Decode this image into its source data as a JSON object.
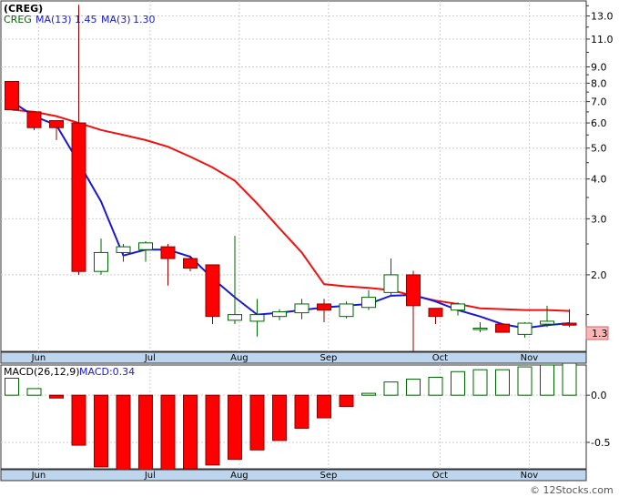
{
  "header": {
    "symbol": "(CREG)",
    "ticker": "CREG",
    "ma13_label": "MA(13)",
    "ma13_value": "1.45",
    "ma3_label": "MA(3)",
    "ma3_value": "1.30"
  },
  "macd_header": {
    "label": "MACD(26,12,9)",
    "value_label": "MACD:0.34"
  },
  "watermark": "© 12Stocks.com",
  "last_price_tag": "1.3",
  "colors": {
    "up_fill": "#ffffff",
    "up_stroke": "#006400",
    "down_fill": "#ff0000",
    "down_stroke": "#8b0000",
    "ma13": "#ee1111",
    "ma3": "#1a1acc",
    "macd_up": "#ffffff",
    "macd_up_stroke": "#006400",
    "macd_down": "#ff0000",
    "grid": "#cccccc",
    "axis_bar": "#bdd6ee",
    "price_tag_bg": "#f8b8b8"
  },
  "chart_data": [
    {
      "type": "candlestick",
      "title": "(CREG)",
      "y_scale": "log",
      "ylim": [
        1.15,
        14.5
      ],
      "y_ticks": [
        13.0,
        11.0,
        9.0,
        8.0,
        7.0,
        6.0,
        5.0,
        4.0,
        3.0,
        2.0
      ],
      "y_tick_labels": [
        "13.0",
        "11.0",
        "9.0",
        "8.0",
        "7.0",
        "6.0",
        "5.0",
        "4.0",
        "3.0",
        "2.0"
      ],
      "x_tick_labels": [
        "Jun",
        "Jul",
        "Aug",
        "Sep",
        "Oct",
        "Nov"
      ],
      "x_tick_positions": [
        1.2,
        6.2,
        10.2,
        14.2,
        19.2,
        23.2
      ],
      "grid": true,
      "candles": [
        {
          "o": 8.1,
          "h": 8.1,
          "l": 6.6,
          "c": 6.6
        },
        {
          "o": 6.5,
          "h": 6.5,
          "l": 5.7,
          "c": 5.8
        },
        {
          "o": 6.1,
          "h": 6.1,
          "l": 5.3,
          "c": 5.8
        },
        {
          "o": 6.0,
          "h": 14.1,
          "l": 2.0,
          "c": 2.05
        },
        {
          "o": 2.05,
          "h": 2.6,
          "l": 2.0,
          "c": 2.35
        },
        {
          "o": 2.35,
          "h": 2.5,
          "l": 2.2,
          "c": 2.45
        },
        {
          "o": 2.4,
          "h": 2.55,
          "l": 2.2,
          "c": 2.52
        },
        {
          "o": 2.45,
          "h": 2.5,
          "l": 1.85,
          "c": 2.25
        },
        {
          "o": 2.25,
          "h": 2.3,
          "l": 2.05,
          "c": 2.1
        },
        {
          "o": 2.15,
          "h": 2.15,
          "l": 1.4,
          "c": 1.48
        },
        {
          "o": 1.44,
          "h": 2.65,
          "l": 1.4,
          "c": 1.5
        },
        {
          "o": 1.43,
          "h": 1.68,
          "l": 1.28,
          "c": 1.5
        },
        {
          "o": 1.48,
          "h": 1.56,
          "l": 1.44,
          "c": 1.53
        },
        {
          "o": 1.52,
          "h": 1.68,
          "l": 1.45,
          "c": 1.62
        },
        {
          "o": 1.62,
          "h": 1.68,
          "l": 1.42,
          "c": 1.55
        },
        {
          "o": 1.48,
          "h": 1.65,
          "l": 1.46,
          "c": 1.62
        },
        {
          "o": 1.58,
          "h": 1.79,
          "l": 1.55,
          "c": 1.7
        },
        {
          "o": 1.76,
          "h": 2.25,
          "l": 1.72,
          "c": 2.0
        },
        {
          "o": 2.0,
          "h": 2.06,
          "l": 1.15,
          "c": 1.6
        },
        {
          "o": 1.57,
          "h": 1.57,
          "l": 1.4,
          "c": 1.48
        },
        {
          "o": 1.55,
          "h": 1.64,
          "l": 1.49,
          "c": 1.62
        },
        {
          "o": 1.36,
          "h": 1.42,
          "l": 1.32,
          "c": 1.36
        },
        {
          "o": 1.4,
          "h": 1.4,
          "l": 1.32,
          "c": 1.32
        },
        {
          "o": 1.3,
          "h": 1.42,
          "l": 1.27,
          "c": 1.41
        },
        {
          "o": 1.4,
          "h": 1.6,
          "l": 1.37,
          "c": 1.43
        },
        {
          "o": 1.41,
          "h": 1.56,
          "l": 1.37,
          "c": 1.39
        }
      ],
      "series": [
        {
          "name": "MA(13)",
          "color": "#ee1111",
          "values": [
            6.6,
            6.5,
            6.3,
            6.0,
            5.7,
            5.5,
            5.3,
            5.05,
            4.7,
            4.35,
            3.95,
            3.35,
            2.8,
            2.35,
            1.87,
            1.84,
            1.82,
            1.79,
            1.72,
            1.66,
            1.62,
            1.57,
            1.56,
            1.55,
            1.55,
            1.54
          ]
        },
        {
          "name": "MA(3)",
          "color": "#1a1acc",
          "values": [
            7.0,
            6.3,
            5.9,
            4.5,
            3.4,
            2.3,
            2.4,
            2.4,
            2.28,
            1.95,
            1.7,
            1.5,
            1.52,
            1.55,
            1.58,
            1.6,
            1.62,
            1.72,
            1.73,
            1.65,
            1.55,
            1.48,
            1.4,
            1.36,
            1.39,
            1.41
          ]
        }
      ]
    },
    {
      "type": "bar",
      "title": "MACD(26,12,9)",
      "ylim": [
        -0.78,
        0.32
      ],
      "y_ticks": [
        0.0,
        -0.5
      ],
      "y_tick_labels": [
        "0.0",
        "-0.5"
      ],
      "x_tick_labels": [
        "Jun",
        "Jul",
        "Aug",
        "Sep",
        "Oct",
        "Nov"
      ],
      "grid": true,
      "series": [
        {
          "name": "MACD",
          "values": [
            0.18,
            0.07,
            -0.03,
            -0.53,
            -0.76,
            -0.82,
            -0.83,
            -0.82,
            -0.78,
            -0.74,
            -0.68,
            -0.58,
            -0.48,
            -0.35,
            -0.24,
            -0.12,
            0.02,
            0.14,
            0.17,
            0.19,
            0.25,
            0.27,
            0.27,
            0.3,
            0.32,
            0.34
          ]
        }
      ]
    }
  ]
}
